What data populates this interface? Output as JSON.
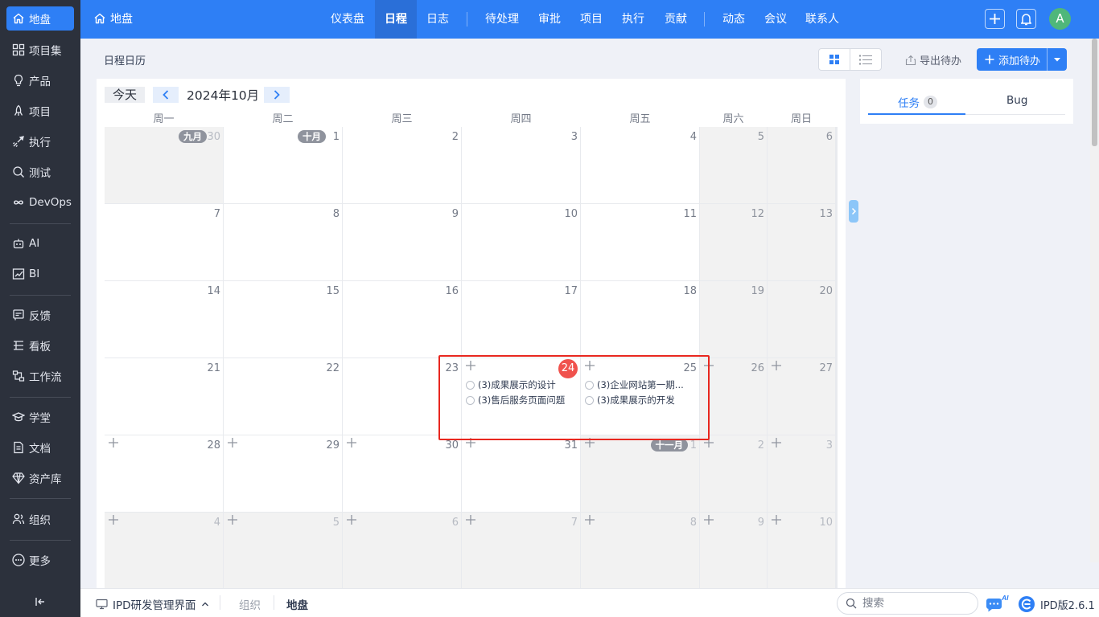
{
  "sidebar": {
    "items": [
      {
        "label": "地盘",
        "icon": "home-icon",
        "active": true
      },
      {
        "label": "项目集",
        "icon": "grid-icon"
      },
      {
        "label": "产品",
        "icon": "lightbulb-icon"
      },
      {
        "label": "项目",
        "icon": "rocket-icon"
      },
      {
        "label": "执行",
        "icon": "launch-icon"
      },
      {
        "label": "测试",
        "icon": "bug-search-icon"
      },
      {
        "label": "DevOps",
        "icon": "infinity-icon"
      },
      {
        "label": "AI",
        "icon": "robot-icon"
      },
      {
        "label": "BI",
        "icon": "chart-icon"
      },
      {
        "label": "反馈",
        "icon": "feedback-icon"
      },
      {
        "label": "看板",
        "icon": "kanban-icon"
      },
      {
        "label": "工作流",
        "icon": "workflow-icon"
      },
      {
        "label": "学堂",
        "icon": "graduation-icon"
      },
      {
        "label": "文档",
        "icon": "document-icon"
      },
      {
        "label": "资产库",
        "icon": "diamond-icon"
      },
      {
        "label": "组织",
        "icon": "people-icon"
      },
      {
        "label": "更多",
        "icon": "more-icon"
      }
    ]
  },
  "topbar": {
    "home_label": "地盘",
    "nav": [
      {
        "label": "仪表盘"
      },
      {
        "label": "日程",
        "active": true
      },
      {
        "label": "日志"
      },
      {
        "label": "待处理"
      },
      {
        "label": "审批"
      },
      {
        "label": "项目"
      },
      {
        "label": "执行"
      },
      {
        "label": "贡献"
      },
      {
        "label": "动态"
      },
      {
        "label": "会议"
      },
      {
        "label": "联系人"
      }
    ],
    "avatar_letter": "A"
  },
  "header": {
    "title": "日程日历",
    "export_label": "导出待办",
    "add_label": "添加待办"
  },
  "calendar": {
    "today_label": "今天",
    "month_label": "2024年10月",
    "weekdays": [
      "周一",
      "周二",
      "周三",
      "周四",
      "周五",
      "周六",
      "周日"
    ],
    "weeks": [
      [
        {
          "day": "30",
          "tag": "九月",
          "other": true
        },
        {
          "day": "1",
          "tag": "十月"
        },
        {
          "day": "2"
        },
        {
          "day": "3"
        },
        {
          "day": "4"
        },
        {
          "day": "5"
        },
        {
          "day": "6"
        }
      ],
      [
        {
          "day": "7"
        },
        {
          "day": "8"
        },
        {
          "day": "9"
        },
        {
          "day": "10"
        },
        {
          "day": "11"
        },
        {
          "day": "12"
        },
        {
          "day": "13"
        }
      ],
      [
        {
          "day": "14"
        },
        {
          "day": "15"
        },
        {
          "day": "16"
        },
        {
          "day": "17"
        },
        {
          "day": "18"
        },
        {
          "day": "19"
        },
        {
          "day": "20"
        }
      ],
      [
        {
          "day": "21"
        },
        {
          "day": "22"
        },
        {
          "day": "23"
        },
        {
          "day": "24",
          "today": true,
          "add": true,
          "events": [
            "(3)成果展示的设计",
            "(3)售后服务页面问题"
          ]
        },
        {
          "day": "25",
          "add": true,
          "events": [
            "(3)企业网站第一期...",
            "(3)成果展示的开发"
          ]
        },
        {
          "day": "26",
          "add": true
        },
        {
          "day": "27",
          "add": true
        }
      ],
      [
        {
          "day": "28",
          "add": true
        },
        {
          "day": "29",
          "add": true
        },
        {
          "day": "30",
          "add": true
        },
        {
          "day": "31",
          "add": true
        },
        {
          "day": "1",
          "tag": "十一月",
          "other": true,
          "add": true
        },
        {
          "day": "2",
          "other": true,
          "add": true
        },
        {
          "day": "3",
          "other": true,
          "add": true
        }
      ],
      [
        {
          "day": "4",
          "other": true,
          "add": true
        },
        {
          "day": "5",
          "other": true,
          "add": true
        },
        {
          "day": "6",
          "other": true,
          "add": true
        },
        {
          "day": "7",
          "other": true,
          "add": true
        },
        {
          "day": "8",
          "other": true,
          "add": true
        },
        {
          "day": "9",
          "other": true,
          "add": true
        },
        {
          "day": "10",
          "other": true,
          "add": true
        }
      ]
    ]
  },
  "right_panel": {
    "tabs": [
      {
        "label": "任务",
        "count": "0",
        "active": true
      },
      {
        "label": "Bug"
      }
    ]
  },
  "bottombar": {
    "app_label": "IPD研发管理界面",
    "crumb_org": "组织",
    "crumb_current": "地盘",
    "search_placeholder": "搜索",
    "ai_badge": "AI",
    "version": "IPD版2.6.1"
  },
  "colors": {
    "primary": "#2e7ff5",
    "sidebar_bg": "#2c313c",
    "today": "#f0524d",
    "highlight": "#e8271f"
  }
}
